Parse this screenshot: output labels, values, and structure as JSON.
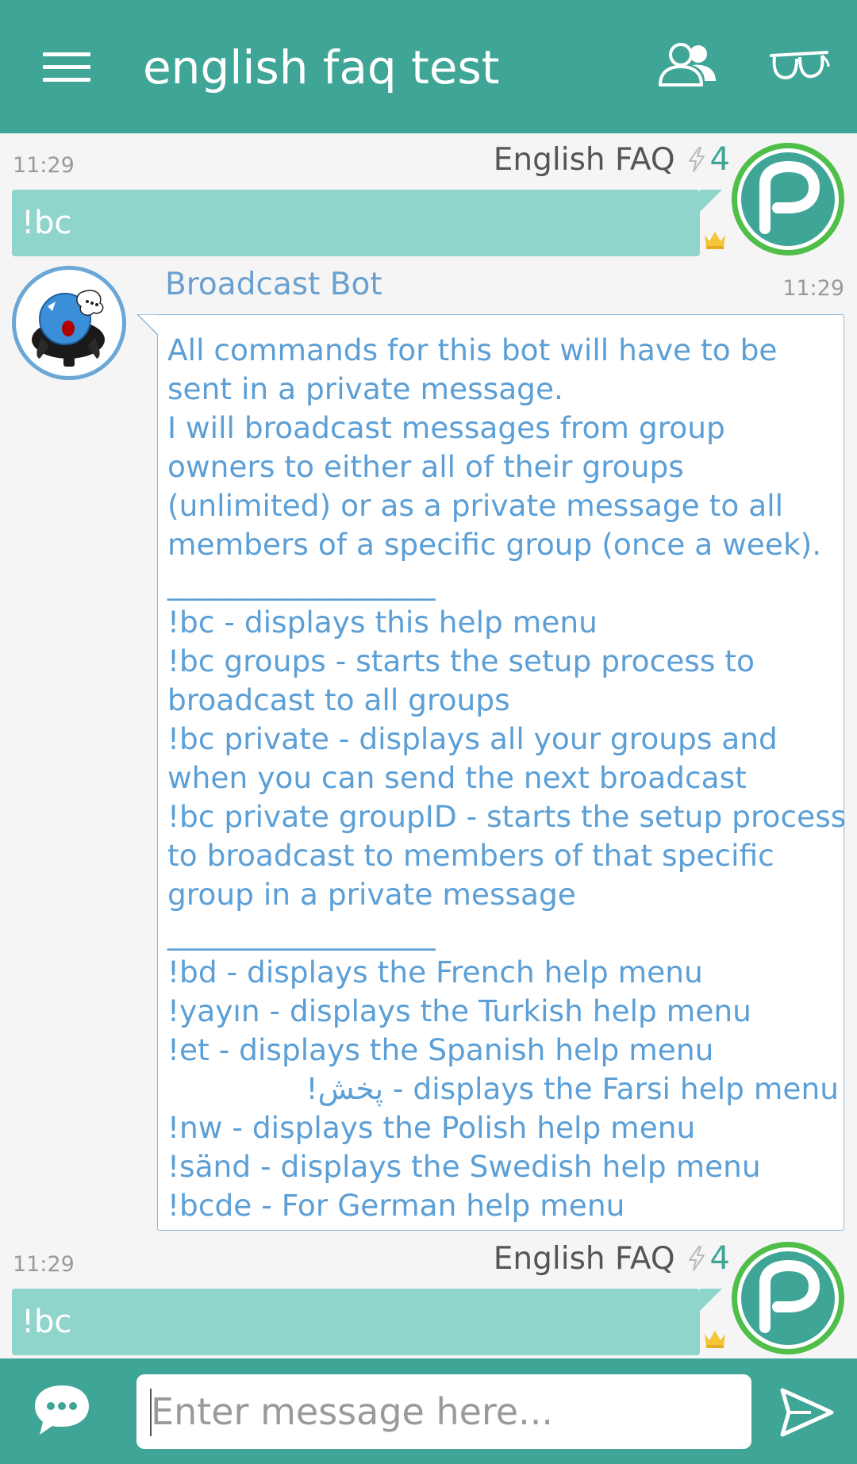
{
  "header": {
    "title": "english faq test",
    "menu_icon": "hamburger-menu-icon",
    "members_icon": "group-members-icon",
    "lurk_icon": "glasses-icon",
    "bg_color": "#3fa597"
  },
  "messages": [
    {
      "time": "11:29",
      "sender": "English FAQ",
      "reputation": "4",
      "text": "!bc"
    },
    {
      "sender": "Broadcast Bot",
      "time": "11:29",
      "lines": [
        "All commands for this bot will have to be",
        "sent in a private message.",
        "I will broadcast messages from group",
        "owners to either all of their groups",
        "(unlimited) or as a private message to all",
        "members of a specific group (once a week).",
        "__________________",
        "!bc - displays this help menu",
        "!bc groups - starts the setup process to",
        "broadcast to all groups",
        "!bc private - displays all your groups and",
        "when you can send the next broadcast",
        "!bc private groupID - starts the setup process",
        "to broadcast to members of that specific",
        "group in a private message",
        "__________________",
        "!bd - displays the French help menu",
        "!yayın - displays the Turkish help menu",
        "!et - displays the Spanish help menu",
        "!پخش - displays the Farsi help menu",
        "!nw - displays the Polish help menu",
        "!sänd - displays the Swedish help menu",
        "!bcde - For German help menu"
      ]
    },
    {
      "time": "11:29",
      "sender": "English FAQ",
      "reputation": "4",
      "text": "!bc"
    }
  ],
  "composer": {
    "placeholder": "Enter message here...",
    "chat_icon": "chat-bubble-icon",
    "send_icon": "send-icon"
  },
  "colors": {
    "accent": "#3fa597",
    "outgoing_bubble": "#8fd5cb",
    "bot_text": "#5b9fd6",
    "avatar_ring": "#4fbf4a",
    "crown": "#f5c53a"
  }
}
